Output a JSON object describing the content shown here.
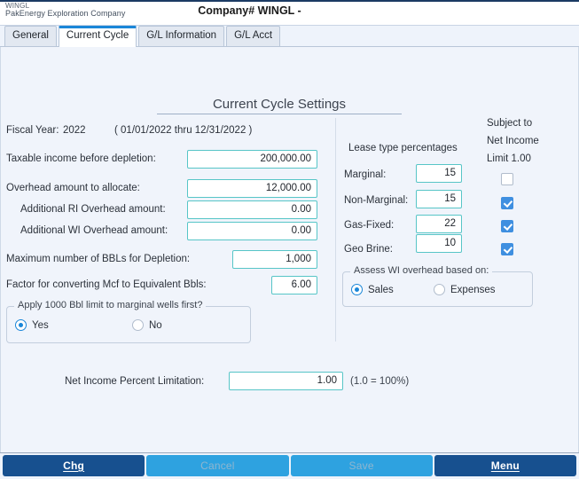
{
  "titlebar": {
    "brand_code": "WINGL",
    "brand_name": "PakEnergy Exploration Company",
    "window_title": "Company# WINGL -"
  },
  "tabs": [
    {
      "label": "General",
      "active": false
    },
    {
      "label": "Current Cycle",
      "active": true
    },
    {
      "label": "G/L Information",
      "active": false
    },
    {
      "label": "G/L Acct",
      "active": false
    }
  ],
  "page": {
    "heading": "Current Cycle Settings",
    "fiscal": {
      "label": "Fiscal Year:",
      "year": "2022",
      "range": "( 01/01/2022   thru   12/31/2022 )"
    },
    "fields": [
      {
        "label": "Taxable income before depletion:",
        "value": "200,000.00"
      },
      {
        "label": "Overhead amount to allocate:",
        "value": "12,000.00"
      },
      {
        "label": "Additional RI Overhead amount:",
        "value": "0.00"
      },
      {
        "label": "Additional WI Overhead amount:",
        "value": "0.00"
      },
      {
        "label": "Maximum number of BBLs for Depletion:",
        "value": "1,000"
      },
      {
        "label": "Factor for converting Mcf to Equivalent Bbls:",
        "value": "6.00"
      }
    ],
    "marginal_group": {
      "title": "Apply 1000 Bbl limit to marginal wells first?",
      "options": [
        {
          "label": "Yes",
          "selected": true
        },
        {
          "label": "No",
          "selected": false
        }
      ]
    },
    "lease": {
      "title": "Lease type percentages",
      "subject_title_line1": "Subject to",
      "subject_title_line2": "Net Income",
      "subject_title_line3": "Limit 1.00",
      "rows": [
        {
          "label": "Marginal:",
          "value": "15",
          "checked": false
        },
        {
          "label": "Non-Marginal:",
          "value": "15",
          "checked": true
        },
        {
          "label": "Gas-Fixed:",
          "value": "22",
          "checked": true
        },
        {
          "label": "Geo Brine:",
          "value": "10",
          "checked": true
        }
      ]
    },
    "assess_group": {
      "title": "Assess WI overhead based on:",
      "options": [
        {
          "label": "Sales",
          "selected": true
        },
        {
          "label": "Expenses",
          "selected": false
        }
      ]
    },
    "net_income": {
      "label": "Net Income Percent Limitation:",
      "value": "1.00",
      "hint": "(1.0 = 100%)"
    }
  },
  "footer": {
    "buttons": [
      {
        "label": "Chg",
        "accel": "C",
        "state": "primary"
      },
      {
        "label": "Cancel",
        "accel": "",
        "state": "disabled"
      },
      {
        "label": "Save",
        "accel": "",
        "state": "disabled"
      },
      {
        "label": "Menu",
        "accel": "M",
        "state": "primary"
      }
    ]
  },
  "colors": {
    "accent_blue": "#1a86d8",
    "field_border": "#57c5c7",
    "button_primary": "#17508f",
    "button_disabled": "#2ea2e0",
    "page_bg": "#f0f4fb"
  }
}
